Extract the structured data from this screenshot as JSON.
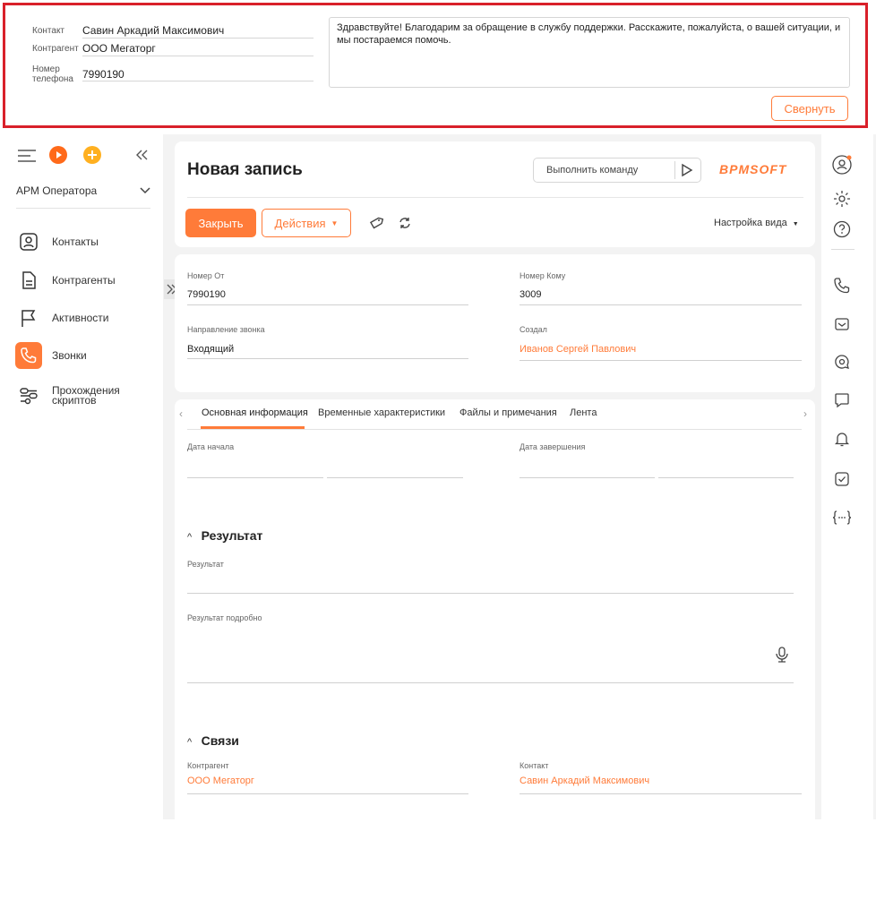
{
  "operator_panel": {
    "contact_label": "Контакт",
    "contact_value": "Савин Аркадий Максимович",
    "account_label": "Контрагент",
    "account_value": "ООО Мегаторг",
    "phone_label_1": "Номер",
    "phone_label_2": "телефона",
    "phone_value": "7990190",
    "script_text": "Здравствуйте! Благодарим за обращение в службу поддержки. Расскажите, пожалуйста, о вашей ситуации, и мы постараемся помочь.",
    "collapse_label": "Свернуть"
  },
  "sidebar": {
    "workplace": "АРМ Оператора",
    "items": [
      {
        "label": "Контакты",
        "icon": "contact-icon"
      },
      {
        "label": "Контрагенты",
        "icon": "document-icon"
      },
      {
        "label": "Активности",
        "icon": "flag-icon"
      },
      {
        "label": "Звонки",
        "icon": "phone-icon",
        "active": true
      },
      {
        "label_1": "Прохождения",
        "label_2": "скриптов",
        "icon": "scripts-icon"
      }
    ]
  },
  "header": {
    "title": "Новая запись",
    "command_placeholder": "Выполнить команду",
    "brand": "BPMSOFT",
    "close_label": "Закрыть",
    "actions_label": "Действия",
    "view_settings_label": "Настройка вида"
  },
  "fields": {
    "from_label": "Номер От",
    "from_value": "7990190",
    "to_label": "Номер Кому",
    "to_value": "3009",
    "direction_label": "Направление звонка",
    "direction_value": "Входящий",
    "created_label": "Создал",
    "created_value": "Иванов Сергей Павлович"
  },
  "tabs": [
    "Основная информация",
    "Временные характеристики",
    "Файлы и примечания",
    "Лента"
  ],
  "main_info": {
    "start_label": "Дата начала",
    "end_label": "Дата завершения"
  },
  "result_section": {
    "title": "Результат",
    "result_label": "Результат",
    "details_label": "Результат подробно"
  },
  "links_section": {
    "title": "Связи",
    "account_label": "Контрагент",
    "account_value": "ООО Мегаторг",
    "contact_label": "Контакт",
    "contact_value": "Савин Аркадий Максимович"
  },
  "colors": {
    "accent": "#ff7b39",
    "highlight_border": "#d9202a"
  }
}
